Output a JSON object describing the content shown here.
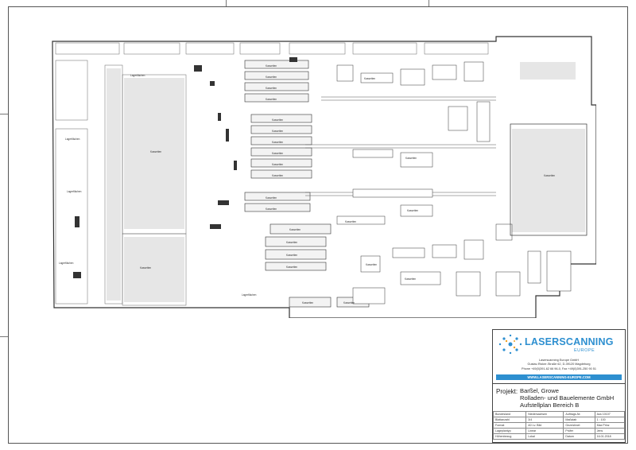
{
  "title_block": {
    "logo_word_1": "LASERSCANNING",
    "logo_word_2": "",
    "logo_sub": "EUROPE",
    "company": "Laserscanning Europe GmbH",
    "street": "Gustav-Ricker-Straße 62, D-39120 Magdeburg",
    "phone": "Phone +49(0)391-62 66 96-0, Fax +49(0)391-250 90 51",
    "website": "WWW.LASERSCANNING-EUROPE.COM",
    "project_label": "Projekt:",
    "project_lines": [
      "Barßel, Growe",
      "Rolladen- und Bauelemente GmbH",
      "Aufstellplan Bereich B"
    ],
    "meta_rows": [
      [
        "Bundesland",
        "Niedersachsen",
        "Auftrags-Nr.",
        "Aus 10107"
      ],
      [
        "Blattanzahl",
        "3/4",
        "Maßstab",
        "1 : 100"
      ],
      [
        "Format",
        "A0 Lv. Bild",
        "Gezeichnet",
        "Max Prinz"
      ],
      [
        "Lageplantyp",
        "Linear",
        "Prüfer",
        "Jens"
      ],
      [
        "Höhenbezug",
        "Lokal",
        "Datum",
        "16.01.2018"
      ]
    ]
  },
  "plan_labels": {
    "l1": "Lagerflächen",
    "l2": "Kassetten",
    "l3": "Kassetten",
    "l4": "Kassetten",
    "l5": "Lagerflächen",
    "l6": "Kassetten",
    "l7": "Kassetten",
    "l8": "Kassetten",
    "l9": "Kassetten",
    "l10": "Kassetten",
    "l11": "Lagerflächen",
    "l12": "Lagerflächen",
    "l13": "Kassetten",
    "l14": "Kassetten",
    "l15": "Kassetten",
    "l16": "Kassetten",
    "l17": "Kassetten",
    "l18": "Kassetten",
    "l19": "Kassetten",
    "l20": "Lagerflächen",
    "l21": "Kassetten",
    "l22": "Kassetten",
    "l23": "Kassetten",
    "l24": "Kassetten",
    "l25": "Kassetten",
    "l26": "Kassetten",
    "l27": "Kassetten",
    "l28": "Kassetten",
    "l29": "Kassetten",
    "l30": "Kassetten",
    "l31": "Kassetten",
    "l32": "Kassetten"
  },
  "colors": {
    "brand_blue": "#2d8fd0",
    "brand_orange": "#f0a020",
    "line": "#444444"
  }
}
